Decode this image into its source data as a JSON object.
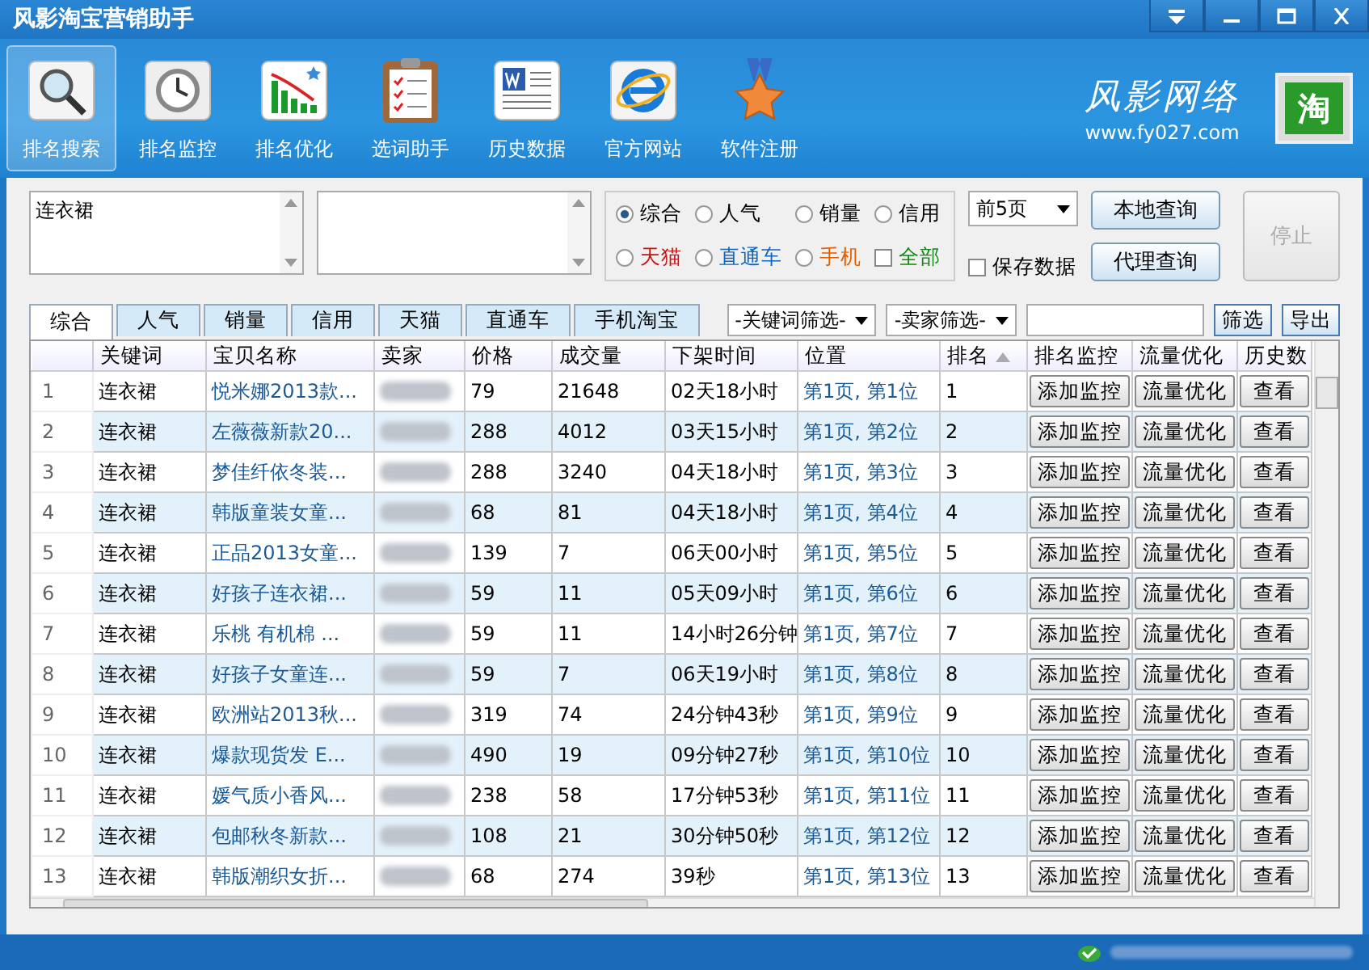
{
  "window": {
    "title": "风影淘宝营销助手"
  },
  "toolbar": [
    {
      "label": "排名搜索",
      "selected": true,
      "kind": "magnifier"
    },
    {
      "label": "排名监控",
      "selected": false,
      "kind": "clock"
    },
    {
      "label": "排名优化",
      "selected": false,
      "kind": "chart"
    },
    {
      "label": "选词助手",
      "selected": false,
      "kind": "clipboard"
    },
    {
      "label": "历史数据",
      "selected": false,
      "kind": "document"
    },
    {
      "label": "官方网站",
      "selected": false,
      "kind": "browser"
    },
    {
      "label": "软件注册",
      "selected": false,
      "kind": "medal"
    }
  ],
  "brand": {
    "name": "风影网络",
    "url": "www.fy027.com",
    "badge": "淘"
  },
  "search": {
    "keywords": "连衣裙",
    "sort_options": [
      {
        "label": "综合",
        "selected": true,
        "color": "#000000"
      },
      {
        "label": "人气",
        "selected": false,
        "color": "#000000"
      },
      {
        "label": "销量",
        "selected": false,
        "color": "#000000"
      },
      {
        "label": "信用",
        "selected": false,
        "color": "#000000"
      },
      {
        "label": "天猫",
        "selected": false,
        "color": "#cc1010"
      },
      {
        "label": "直通车",
        "selected": false,
        "color": "#1066c0"
      },
      {
        "label": "手机",
        "selected": false,
        "color": "#e06000"
      }
    ],
    "all_checkbox": {
      "label": "全部",
      "checked": false,
      "color": "#118811"
    },
    "pages_dropdown": "前5页",
    "save_data": {
      "label": "保存数据",
      "checked": false
    },
    "buttons": [
      {
        "label": "本地查询",
        "disabled": false
      },
      {
        "label": "代理查询",
        "disabled": false
      },
      {
        "label": "停止",
        "disabled": true
      }
    ]
  },
  "result_tabs": [
    {
      "label": "综合",
      "selected": true
    },
    {
      "label": "人气",
      "selected": false
    },
    {
      "label": "销量",
      "selected": false
    },
    {
      "label": "信用",
      "selected": false
    },
    {
      "label": "天猫",
      "selected": false
    },
    {
      "label": "直通车",
      "selected": false
    },
    {
      "label": "手机淘宝",
      "selected": false
    }
  ],
  "filters": {
    "keyword_filter": "-关键词筛选-",
    "seller_filter": "-卖家筛选-",
    "filter_button": "筛选",
    "export_button": "导出"
  },
  "table": {
    "columns": [
      {
        "label": "关键词",
        "sorted": false
      },
      {
        "label": "宝贝名称",
        "sorted": false
      },
      {
        "label": "卖家",
        "sorted": false
      },
      {
        "label": "价格",
        "sorted": false
      },
      {
        "label": "成交量",
        "sorted": false
      },
      {
        "label": "下架时间",
        "sorted": false
      },
      {
        "label": "位置",
        "sorted": false
      },
      {
        "label": "排名",
        "sorted": true
      },
      {
        "label": "排名监控",
        "sorted": false
      },
      {
        "label": "流量优化",
        "sorted": false
      },
      {
        "label": "历史数",
        "sorted": false
      }
    ],
    "rows": [
      {
        "index": "1",
        "keyword": "连衣裙",
        "name": "悦米娜2013款...",
        "price": "79",
        "sales": "21648",
        "time": "02天18小时",
        "position": "第1页, 第1位",
        "rank": "1",
        "actions": [
          "添加监控",
          "流量优化",
          "查看"
        ]
      },
      {
        "index": "2",
        "keyword": "连衣裙",
        "name": "左薇薇新款20...",
        "price": "288",
        "sales": "4012",
        "time": "03天15小时",
        "position": "第1页, 第2位",
        "rank": "2",
        "actions": [
          "添加监控",
          "流量优化",
          "查看"
        ]
      },
      {
        "index": "3",
        "keyword": "连衣裙",
        "name": "梦佳纤依冬装...",
        "price": "288",
        "sales": "3240",
        "time": "04天18小时",
        "position": "第1页, 第3位",
        "rank": "3",
        "actions": [
          "添加监控",
          "流量优化",
          "查看"
        ]
      },
      {
        "index": "4",
        "keyword": "连衣裙",
        "name": "韩版童装女童...",
        "price": "68",
        "sales": "81",
        "time": "04天18小时",
        "position": "第1页, 第4位",
        "rank": "4",
        "actions": [
          "添加监控",
          "流量优化",
          "查看"
        ]
      },
      {
        "index": "5",
        "keyword": "连衣裙",
        "name": "正品2013女童...",
        "price": "139",
        "sales": "7",
        "time": "06天00小时",
        "position": "第1页, 第5位",
        "rank": "5",
        "actions": [
          "添加监控",
          "流量优化",
          "查看"
        ]
      },
      {
        "index": "6",
        "keyword": "连衣裙",
        "name": "好孩子连衣裙...",
        "price": "59",
        "sales": "11",
        "time": "05天09小时",
        "position": "第1页, 第6位",
        "rank": "6",
        "actions": [
          "添加监控",
          "流量优化",
          "查看"
        ]
      },
      {
        "index": "7",
        "keyword": "连衣裙",
        "name": "乐桃 有机棉 ...",
        "price": "59",
        "sales": "11",
        "time": "14小时26分钟",
        "position": "第1页, 第7位",
        "rank": "7",
        "actions": [
          "添加监控",
          "流量优化",
          "查看"
        ]
      },
      {
        "index": "8",
        "keyword": "连衣裙",
        "name": "好孩子女童连...",
        "price": "59",
        "sales": "7",
        "time": "06天19小时",
        "position": "第1页, 第8位",
        "rank": "8",
        "actions": [
          "添加监控",
          "流量优化",
          "查看"
        ]
      },
      {
        "index": "9",
        "keyword": "连衣裙",
        "name": "欧洲站2013秋...",
        "price": "319",
        "sales": "74",
        "time": "24分钟43秒",
        "position": "第1页, 第9位",
        "rank": "9",
        "actions": [
          "添加监控",
          "流量优化",
          "查看"
        ]
      },
      {
        "index": "10",
        "keyword": "连衣裙",
        "name": "爆款现货发 E...",
        "price": "490",
        "sales": "19",
        "time": "09分钟27秒",
        "position": "第1页, 第10位",
        "rank": "10",
        "actions": [
          "添加监控",
          "流量优化",
          "查看"
        ]
      },
      {
        "index": "11",
        "keyword": "连衣裙",
        "name": "媛气质小香风...",
        "price": "238",
        "sales": "58",
        "time": "17分钟53秒",
        "position": "第1页, 第11位",
        "rank": "11",
        "actions": [
          "添加监控",
          "流量优化",
          "查看"
        ]
      },
      {
        "index": "12",
        "keyword": "连衣裙",
        "name": "包邮秋冬新款...",
        "price": "108",
        "sales": "21",
        "time": "30分钟50秒",
        "position": "第1页, 第12位",
        "rank": "12",
        "actions": [
          "添加监控",
          "流量优化",
          "查看"
        ]
      },
      {
        "index": "13",
        "keyword": "连衣裙",
        "name": "韩版潮织女折...",
        "price": "68",
        "sales": "274",
        "time": "39秒",
        "position": "第1页, 第13位",
        "rank": "13",
        "actions": [
          "添加监控",
          "流量优化",
          "查看"
        ]
      }
    ]
  }
}
